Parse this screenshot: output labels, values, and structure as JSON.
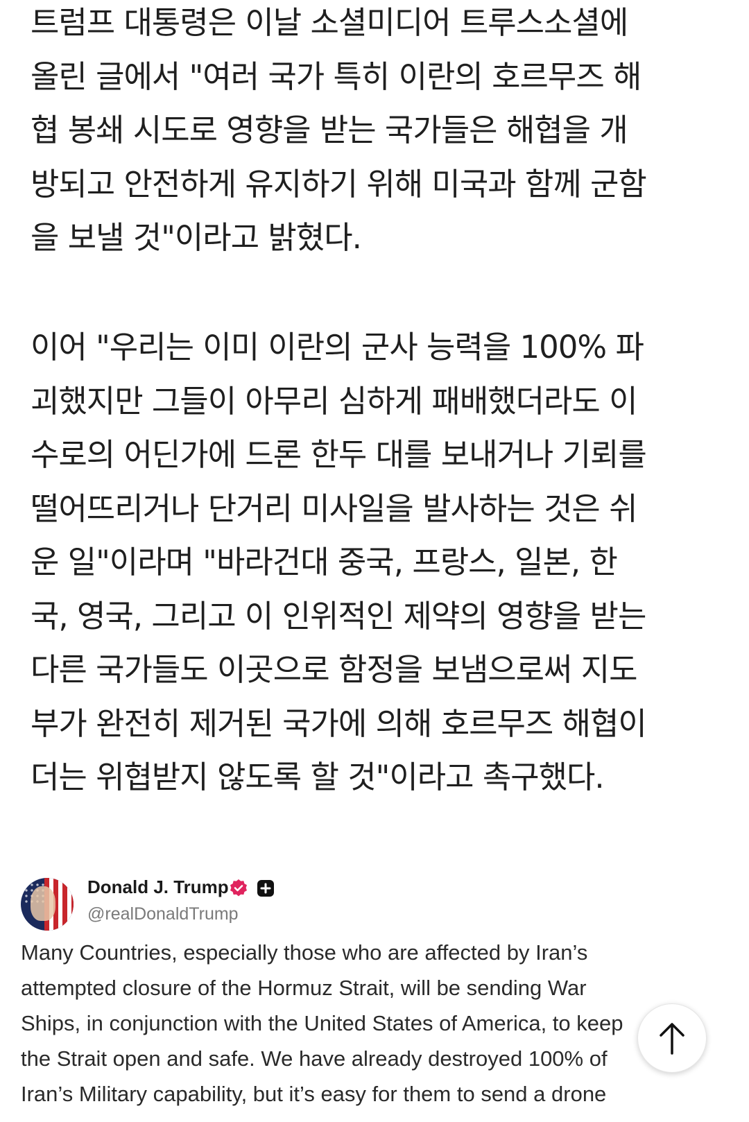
{
  "article": {
    "paragraph1": [
      "트럼프 대통령은 이날 소셜미디어 트루스소셜에",
      "올린 글에서 \"여러 국가 특히 이란의 호르무즈 해",
      "협 봉쇄 시도로 영향을 받는 국가들은 해협을 개",
      "방되고 안전하게 유지하기 위해 미국과 함께 군함",
      "을 보낼 것\"이라고 밝혔다."
    ],
    "paragraph2": [
      "이어 \"우리는 이미 이란의 군사 능력을 100% 파",
      "괴했지만 그들이 아무리 심하게 패배했더라도 이",
      "수로의 어딘가에 드론 한두 대를 보내거나 기뢰를",
      "떨어뜨리거나 단거리 미사일을 발사하는 것은 쉬",
      "운 일\"이라며 \"바라건대 중국, 프랑스, 일본, 한",
      "국, 영국, 그리고 이 인위적인 제약의 영향을 받는",
      "다른 국가들도 이곳으로 함정을 보냄으로써 지도",
      "부가 완전히 제거된 국가에 의해 호르무즈 해협이",
      "더는 위협받지 않도록 할 것\"이라고 촉구했다."
    ]
  },
  "tweet": {
    "display_name": "Donald J. Trump",
    "handle": "@realDonaldTrump",
    "body_lines": [
      "Many Countries, especially those who are affected by Iran’s",
      "attempted closure of the Hormuz Strait, will be sending War",
      "Ships, in conjunction with the United States of America, to keep",
      "the Strait open and safe. We have already destroyed 100% of",
      "Iran’s Military capability, but it’s easy for them to send a drone"
    ],
    "verified_color": "#e0245e"
  },
  "scroll_top": {
    "icon": "arrow-up-icon"
  }
}
